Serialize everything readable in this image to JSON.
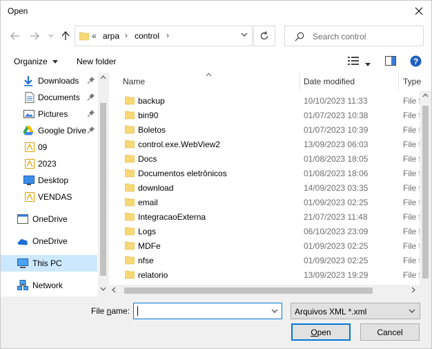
{
  "window": {
    "title": "Open"
  },
  "address": {
    "overflow": "«",
    "segments": [
      "arpa",
      "control"
    ]
  },
  "search": {
    "placeholder": "Search control"
  },
  "toolbar": {
    "organize": "Organize",
    "new_folder": "New folder"
  },
  "sidebar": {
    "items": [
      {
        "label": "Downloads",
        "icon": "download-arrow-icon",
        "pinned": true
      },
      {
        "label": "Documents",
        "icon": "document-icon",
        "pinned": true
      },
      {
        "label": "Pictures",
        "icon": "pictures-icon",
        "pinned": true
      },
      {
        "label": "Google Drive",
        "icon": "google-drive-icon",
        "pinned": true
      },
      {
        "label": "09",
        "icon": "folder-icon",
        "pinned": false
      },
      {
        "label": "2023",
        "icon": "folder-icon",
        "pinned": false
      },
      {
        "label": "Desktop",
        "icon": "desktop-icon",
        "pinned": false
      },
      {
        "label": "VENDAS",
        "icon": "folder-icon",
        "pinned": false
      },
      {
        "label": "OneDrive",
        "icon": "onedrive-icon",
        "pinned": false
      },
      {
        "label": "OneDrive",
        "icon": "onedrive-icon",
        "pinned": false
      },
      {
        "label": "This PC",
        "icon": "this-pc-icon",
        "pinned": false,
        "selected": true
      },
      {
        "label": "Network",
        "icon": "network-icon",
        "pinned": false
      }
    ]
  },
  "columns": {
    "name": "Name",
    "date": "Date modified",
    "type": "Type"
  },
  "files": [
    {
      "name": "backup",
      "date": "10/10/2023 11:33",
      "type": "File f"
    },
    {
      "name": "bin90",
      "date": "01/07/2023 10:38",
      "type": "File f"
    },
    {
      "name": "Boletos",
      "date": "01/07/2023 10:39",
      "type": "File f"
    },
    {
      "name": "control.exe.WebView2",
      "date": "13/09/2023 06:03",
      "type": "File f"
    },
    {
      "name": "Docs",
      "date": "01/08/2023 18:05",
      "type": "File f"
    },
    {
      "name": "Documentos eletrônicos",
      "date": "01/08/2023 18:06",
      "type": "File f"
    },
    {
      "name": "download",
      "date": "14/09/2023 03:35",
      "type": "File f"
    },
    {
      "name": "email",
      "date": "01/09/2023 02:25",
      "type": "File f"
    },
    {
      "name": "IntegracaoExterna",
      "date": "21/07/2023 11:48",
      "type": "File f"
    },
    {
      "name": "Logs",
      "date": "06/10/2023 23:09",
      "type": "File f"
    },
    {
      "name": "MDFe",
      "date": "01/09/2023 02:25",
      "type": "File f"
    },
    {
      "name": "nfse",
      "date": "01/09/2023 02:25",
      "type": "File f"
    },
    {
      "name": "relatorio",
      "date": "13/09/2023 19:29",
      "type": "File f"
    }
  ],
  "bottom": {
    "filename_label_pre": "File ",
    "filename_label_u": "n",
    "filename_label_post": "ame:",
    "filename_value": "",
    "filter": "Arquivos XML *.xml",
    "open_u": "O",
    "open_rest": "pen",
    "cancel": "Cancel"
  },
  "colors": {
    "accent": "#0078d7",
    "selected": "#cce8ff",
    "folder": "#f8d775",
    "help": "#1e5fbf"
  }
}
